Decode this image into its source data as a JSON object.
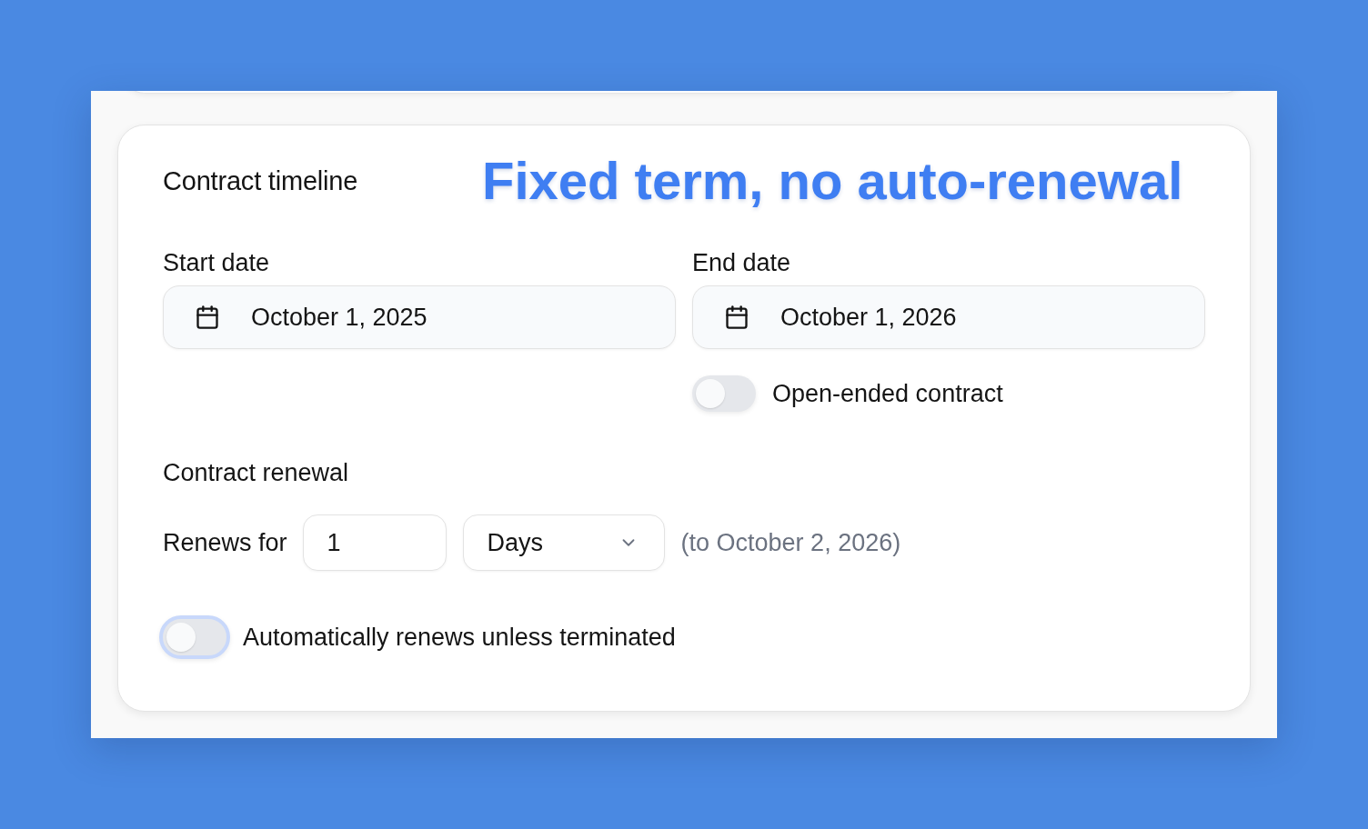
{
  "contract_timeline": {
    "title": "Contract timeline",
    "caption": "Fixed term, no auto-renewal",
    "dates": [
      {
        "label": "Start date",
        "value": "October 1, 2025"
      },
      {
        "label": "End date",
        "value": "October 1, 2026"
      }
    ],
    "open_ended": {
      "label": "Open-ended contract",
      "on": false,
      "focused": false
    },
    "renewal": {
      "heading": "Contract renewal",
      "prefix": "Renews for",
      "count": "1",
      "unit": "Days",
      "hint": "(to October 2, 2026)"
    },
    "auto_renew": {
      "label": "Automatically renews unless terminated",
      "on": false,
      "focused": true
    }
  }
}
